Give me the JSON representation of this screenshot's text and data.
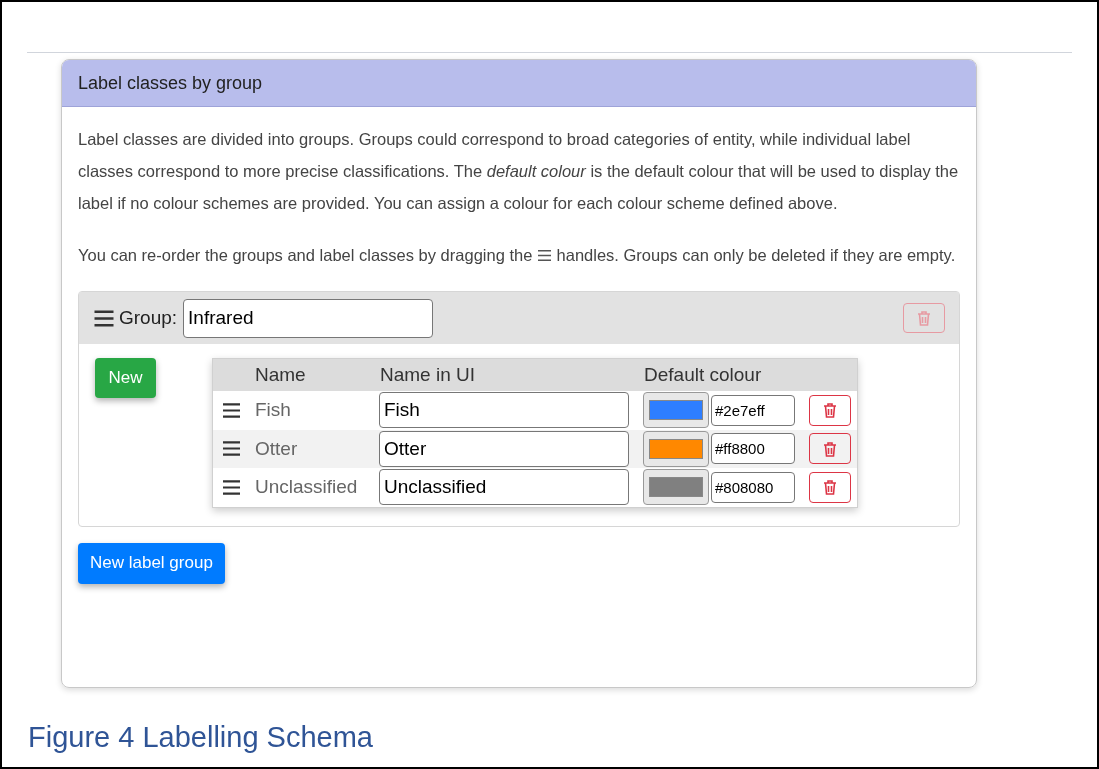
{
  "card": {
    "title": "Label classes by group",
    "paragraph_1": "Label classes are divided into groups. Groups could correspond to broad categories of entity, while individual label classes correspond to more precise classifications. The *default colour* is the default colour that will be used to display the label if no colour schemes are provided. You can assign a colour for each colour scheme defined above.",
    "paragraph_2_before": "You can re-order the groups and label classes by dragging the",
    "paragraph_2_after": "handles. Groups can only be deleted if they are empty.",
    "group": {
      "label": "Group:",
      "name": "Infrared",
      "new_button": "New",
      "columns": [
        "Name",
        "Name in UI",
        "Default colour"
      ],
      "classes": [
        {
          "name": "Fish",
          "name_in_ui": "Fish",
          "color": "#2e7eff",
          "hex": "#2e7eff"
        },
        {
          "name": "Otter",
          "name_in_ui": "Otter",
          "color": "#ff8800",
          "hex": "#ff8800"
        },
        {
          "name": "Unclassified",
          "name_in_ui": "Unclassified",
          "color": "#808080",
          "hex": "#808080"
        }
      ]
    },
    "new_group_button": "New label group"
  },
  "caption": "Figure 4 Labelling Schema"
}
